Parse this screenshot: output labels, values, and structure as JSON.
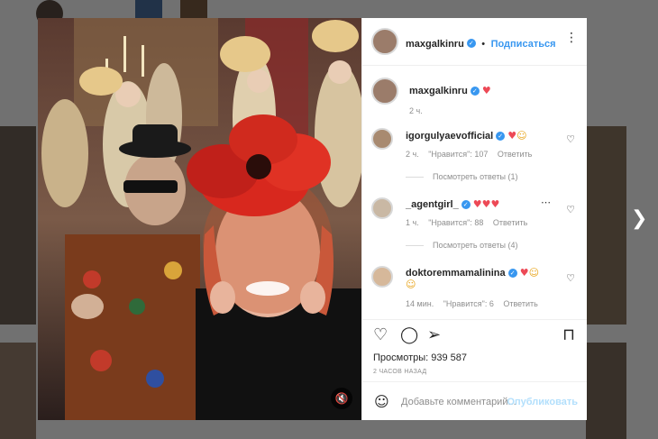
{
  "post": {
    "username": "maxgalkinru",
    "follow_label": "Подписаться",
    "caption_time": "2 ч.",
    "views_label": "Просмотры: 939 587",
    "timestamp": "2 ЧАСОВ НАЗАД"
  },
  "comments": [
    {
      "user": "igorgulyaevofficial",
      "time": "2 ч.",
      "likes": "\"Нравится\": 107",
      "reply": "Ответить",
      "view_replies": "Посмотреть ответы (1)"
    },
    {
      "user": "_agentgirl_",
      "time": "1 ч.",
      "likes": "\"Нравится\": 88",
      "reply": "Ответить",
      "view_replies": "Посмотреть ответы (4)"
    },
    {
      "user": "doktoremmamalinina",
      "time": "14 мин.",
      "likes": "\"Нравится\": 6",
      "reply": "Ответить"
    }
  ],
  "add_comment": {
    "placeholder": "Добавьте комментарий...",
    "publish_label": "Опубликовать"
  },
  "colors": {
    "accent": "#3897f0",
    "heart": "#ed4956"
  }
}
